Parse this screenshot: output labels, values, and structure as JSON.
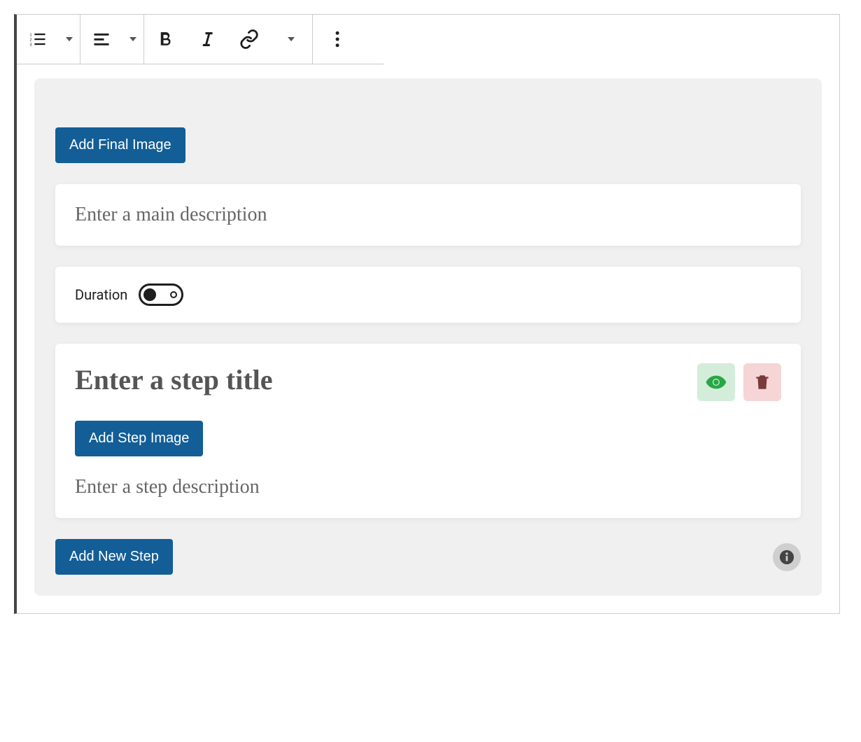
{
  "buttons": {
    "add_final_image": "Add Final Image",
    "add_step_image": "Add Step Image",
    "add_new_step": "Add New Step"
  },
  "placeholders": {
    "main_description": "Enter a main description",
    "step_title": "Enter a step title",
    "step_description": "Enter a step description"
  },
  "labels": {
    "duration": "Duration"
  },
  "toggles": {
    "duration_on": false
  }
}
